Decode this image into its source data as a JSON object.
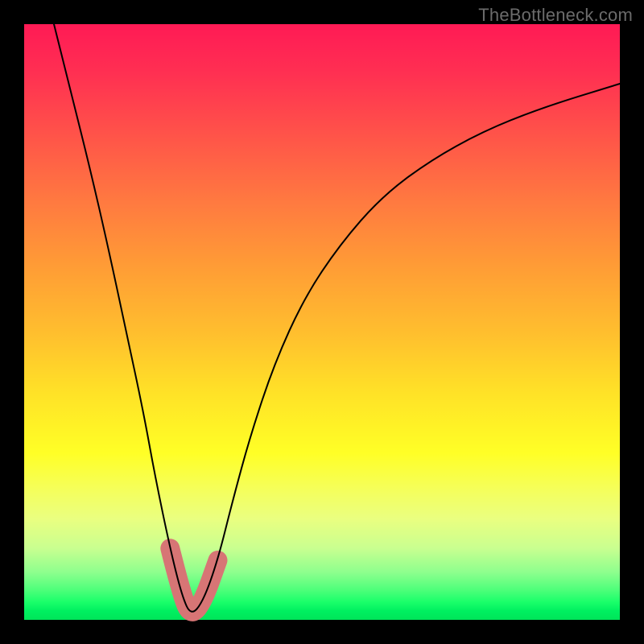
{
  "watermark": "TheBottleneck.com",
  "colors": {
    "frame_bg": "#000000",
    "curve_thin": "#000000",
    "curve_thick": "#d77575",
    "gradient_top": "#ff1a55",
    "gradient_bottom": "#00e459"
  },
  "chart_data": {
    "type": "line",
    "title": "",
    "xlabel": "",
    "ylabel": "",
    "xlim": [
      0,
      100
    ],
    "ylim": [
      0,
      100
    ],
    "note": "V-shaped bottleneck curve on red→green gradient. y is measured from bottom (0) to top (100). Minimum near x≈28.",
    "series": [
      {
        "name": "thin_curve",
        "x": [
          5,
          8,
          11,
          14,
          17,
          20,
          22,
          24.5,
          26.5,
          28,
          30,
          32.5,
          35,
          38,
          42,
          47,
          53,
          60,
          68,
          77,
          87,
          100
        ],
        "y": [
          100,
          88,
          76,
          63,
          49,
          35,
          24,
          12,
          4,
          0.7,
          3,
          10,
          20,
          31,
          43,
          54,
          63,
          71,
          77,
          82,
          86,
          90
        ]
      },
      {
        "name": "thick_highlight",
        "x": [
          24.5,
          26.5,
          28,
          30,
          32.5
        ],
        "y": [
          12,
          4,
          0.7,
          3,
          10
        ]
      }
    ]
  }
}
